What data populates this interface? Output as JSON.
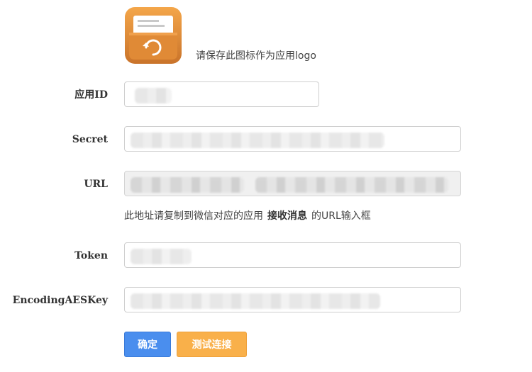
{
  "logo": {
    "icon": "card-box-refresh-icon",
    "hint": "请保存此图标作为应用logo",
    "colors": {
      "top": "#f4a64a",
      "bottom": "#c9732a"
    }
  },
  "fields": [
    {
      "label": "应用ID",
      "value": "",
      "redacted": true,
      "readonly": false
    },
    {
      "label": "Secret",
      "value": "",
      "redacted": true,
      "readonly": false
    },
    {
      "label": "URL",
      "value": "",
      "redacted": true,
      "readonly": true
    },
    {
      "label": "Token",
      "value": "",
      "redacted": true,
      "readonly": false
    },
    {
      "label": "EncodingAESKey",
      "value": "",
      "redacted": true,
      "readonly": false
    }
  ],
  "url_hint": {
    "prefix": "此地址请复制到微信对应的应用",
    "emphasis": "接收消息",
    "suffix": "的URL输入框"
  },
  "buttons": {
    "confirm": "确定",
    "test_connection": "测试连接"
  },
  "colors": {
    "confirm_button": "#4a8eee",
    "test_button": "#f9b04a"
  }
}
